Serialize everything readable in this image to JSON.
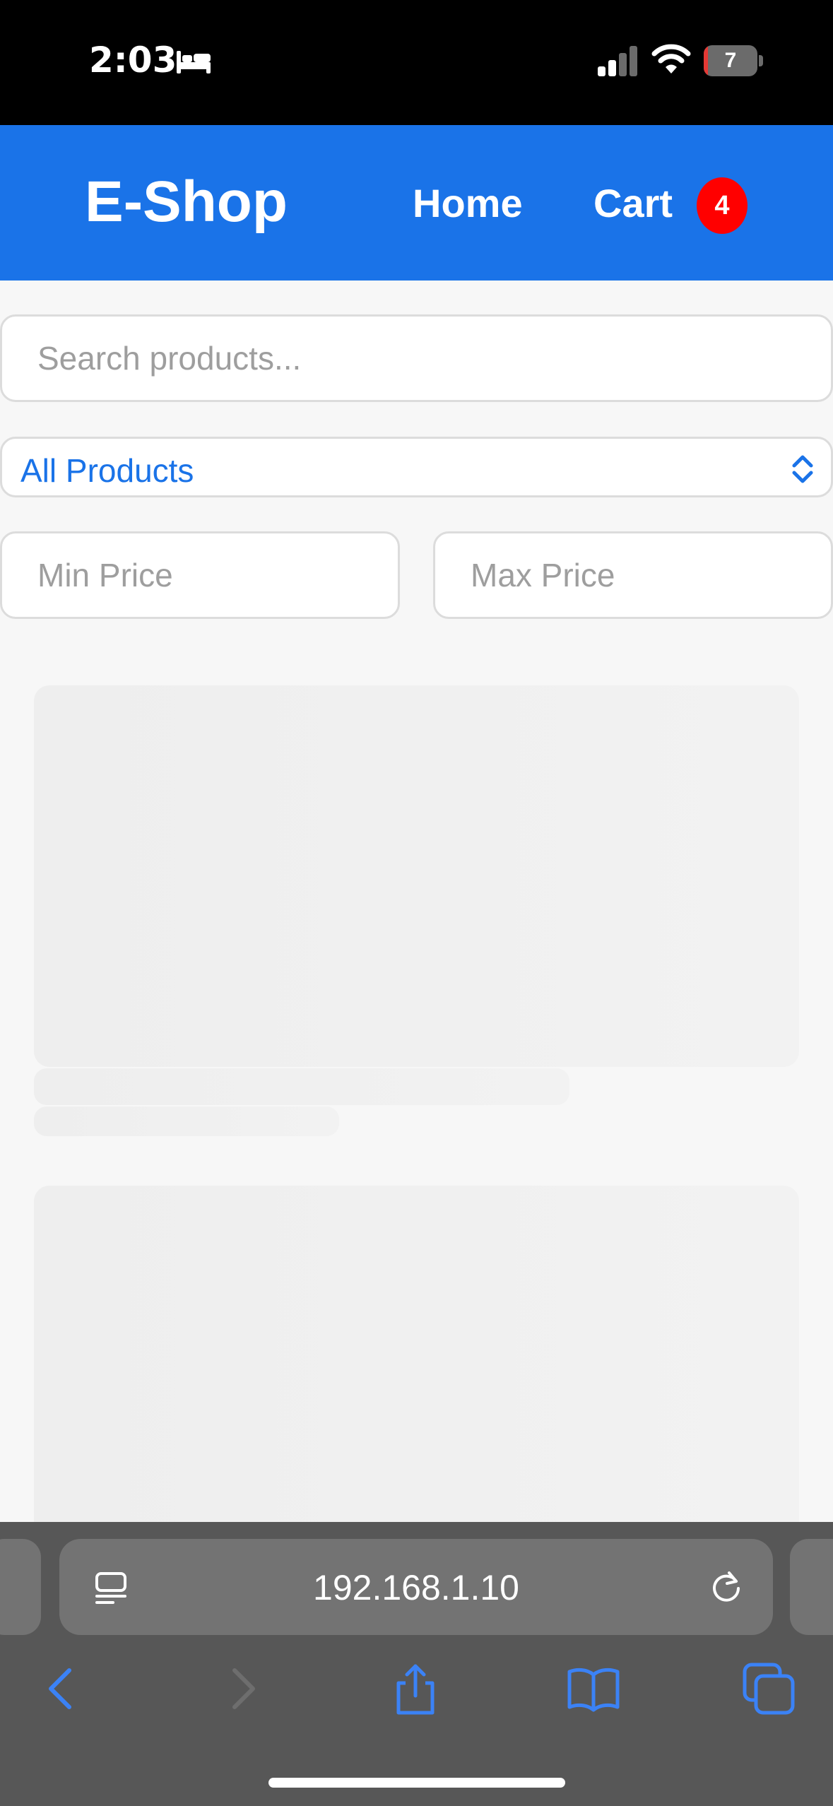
{
  "status_bar": {
    "time": "2:03",
    "battery_level": "7",
    "battery_fraction": 0.07,
    "icons": [
      "bed-icon",
      "signal-icon",
      "wifi-icon",
      "battery-icon"
    ]
  },
  "header": {
    "brand": "E-Shop",
    "nav": {
      "home": "Home",
      "cart": "Cart"
    },
    "cart_count": "4",
    "colors": {
      "bar": "#1a73e8",
      "badge": "#ff0000"
    }
  },
  "filters": {
    "search_placeholder": "Search products...",
    "category_selected": "All Products",
    "min_price_placeholder": "Min Price",
    "max_price_placeholder": "Max Price"
  },
  "loading": {
    "skeleton_cards_visible": 2
  },
  "browser": {
    "url": "192.168.1.10",
    "toolbar_icons": [
      "back-icon",
      "forward-icon",
      "share-icon",
      "bookmarks-icon",
      "tabs-icon"
    ]
  }
}
